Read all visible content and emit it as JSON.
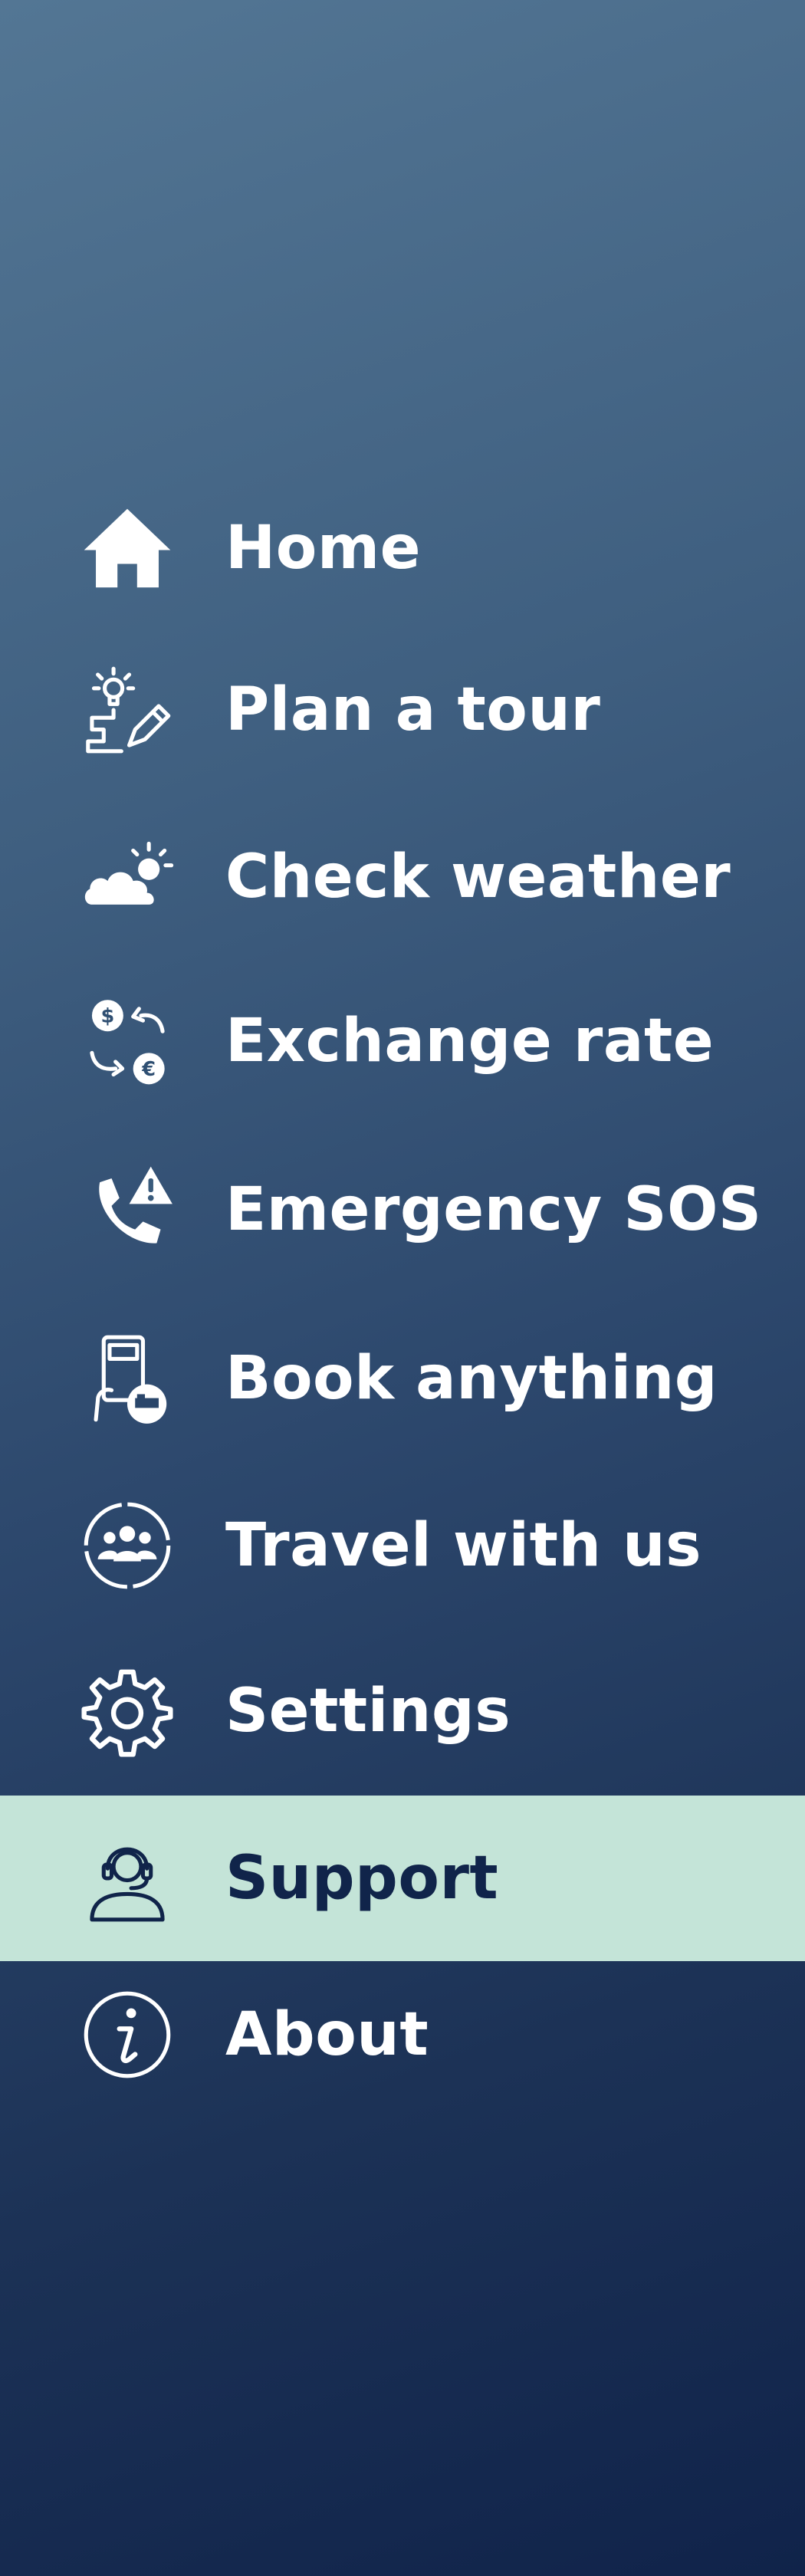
{
  "menu": {
    "items": [
      {
        "label": "Home",
        "icon": "home-icon"
      },
      {
        "label": "Plan a tour",
        "icon": "plan-tour-icon"
      },
      {
        "label": "Check weather",
        "icon": "weather-icon"
      },
      {
        "label": "Exchange rate",
        "icon": "exchange-rate-icon"
      },
      {
        "label": "Emergency SOS",
        "icon": "emergency-phone-icon"
      },
      {
        "label": "Book anything",
        "icon": "booking-icon"
      },
      {
        "label": "Travel with us",
        "icon": "travel-group-icon"
      },
      {
        "label": "Settings",
        "icon": "gear-icon"
      },
      {
        "label": "Support",
        "icon": "support-headset-icon",
        "selected": true
      },
      {
        "label": "About",
        "icon": "info-icon"
      }
    ]
  },
  "colors": {
    "background_top": "#537694",
    "background_bottom": "#10234a",
    "active_background": "#c4e4d8",
    "active_text": "#10244a",
    "text": "#ffffff"
  }
}
